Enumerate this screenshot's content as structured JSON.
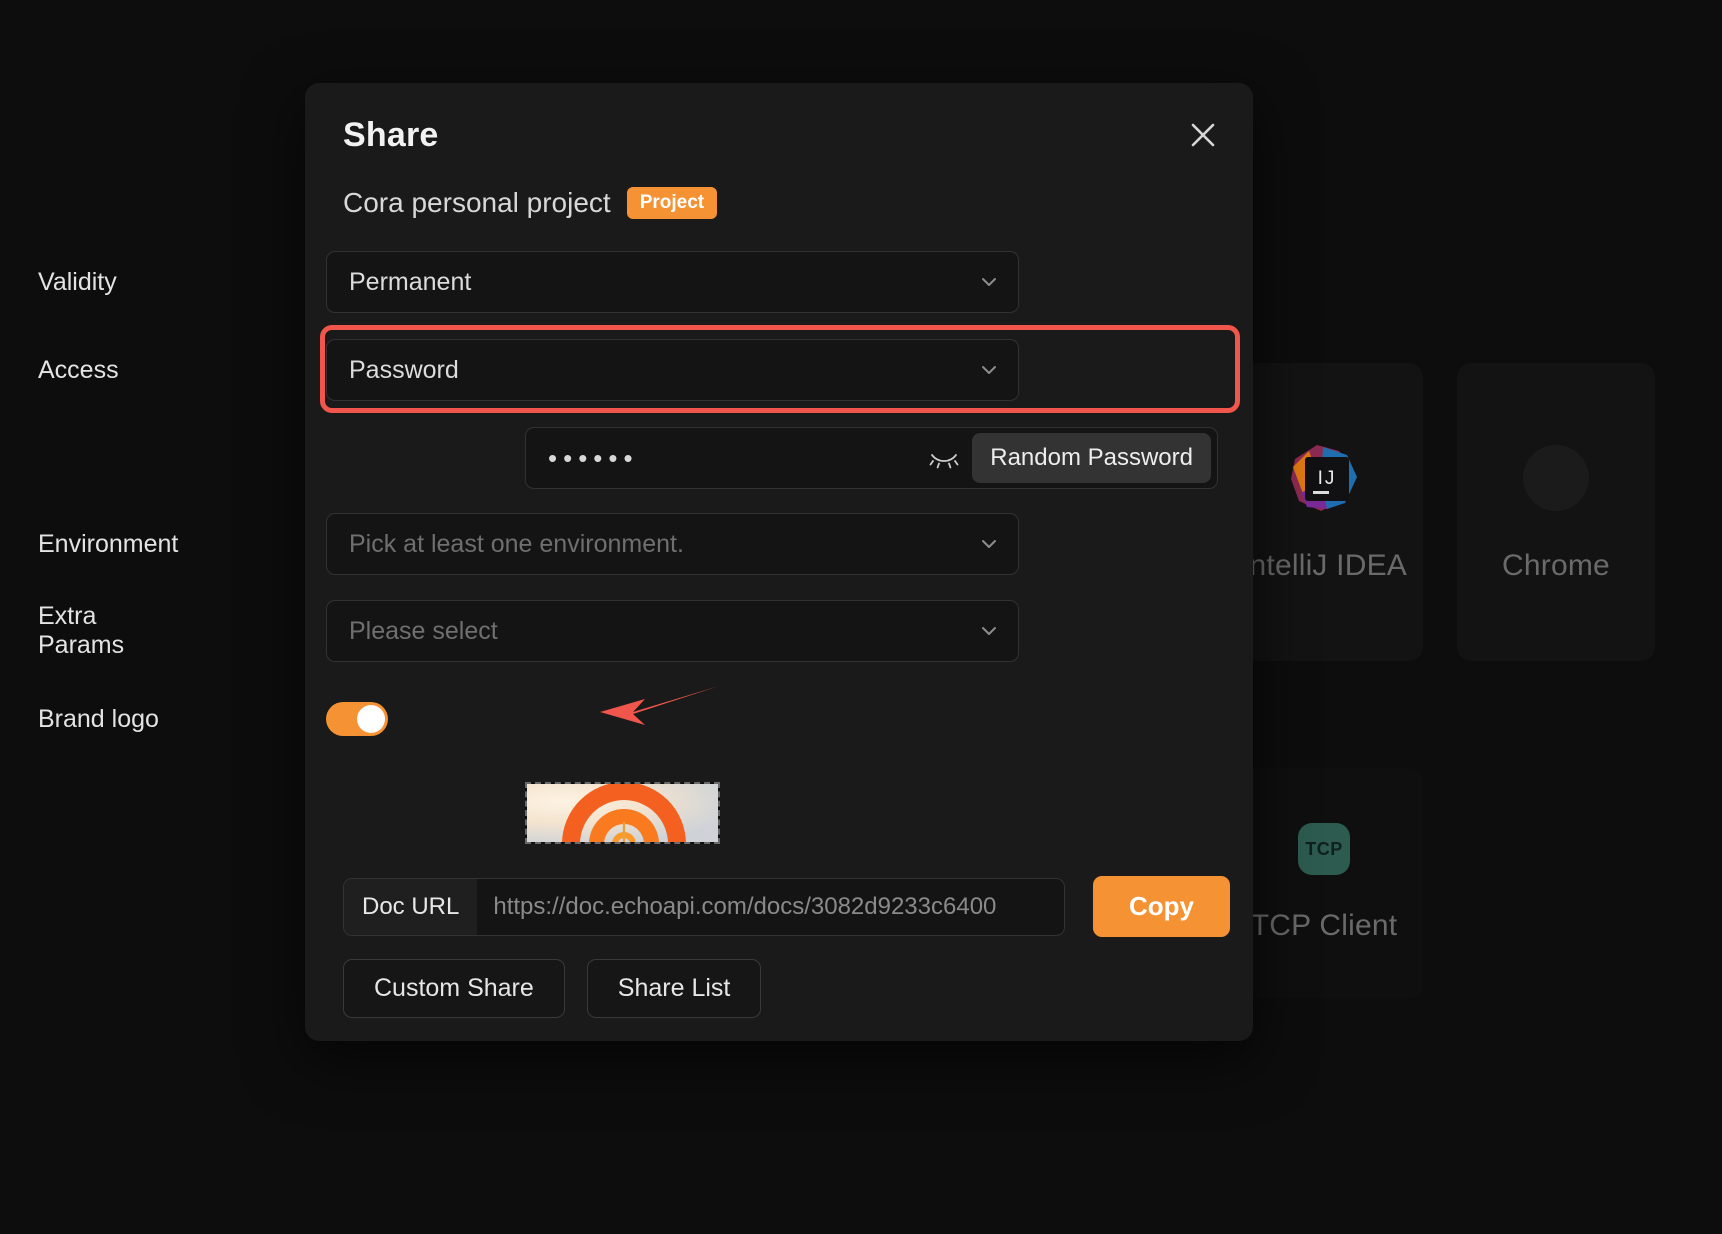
{
  "background": {
    "cards": [
      {
        "label": "IntelliJ IDEA",
        "icon": "intellij-idea-icon",
        "badge_text": "IJ"
      },
      {
        "label": "Chrome",
        "icon": "chrome-icon"
      },
      {
        "label": "TCP Client",
        "icon": "tcp-icon",
        "badge_text": "TCP"
      }
    ]
  },
  "modal": {
    "title": "Share",
    "close_icon": "close-icon",
    "project": {
      "name": "Cora personal project",
      "badge": "Project"
    },
    "rows": {
      "validity": {
        "label": "Validity",
        "value": "Permanent",
        "chevron": "chevron-down-icon"
      },
      "access": {
        "label": "Access",
        "value": "Password",
        "chevron": "chevron-down-icon"
      },
      "password": {
        "value": "••••••",
        "toggle_visibility_icon": "eye-off-icon",
        "random_button": "Random Password"
      },
      "environment": {
        "label": "Environment",
        "placeholder": "Pick at least one environment.",
        "chevron": "chevron-down-icon"
      },
      "extra_params": {
        "label": "Extra Params",
        "placeholder": "Please select",
        "chevron": "chevron-down-icon"
      },
      "brand_logo": {
        "label": "Brand logo",
        "enabled": "on",
        "thumbnail_alt": "brand-logo-thumbnail"
      }
    },
    "doc_url": {
      "label": "Doc URL",
      "value": "https://doc.echoapi.com/docs/3082d9233c6400",
      "copy_button": "Copy"
    },
    "footer": {
      "custom_share": "Custom Share",
      "share_list": "Share List"
    }
  },
  "annotations": {
    "highlight_color": "#f0564b",
    "accent_color": "#f59233",
    "arrow_target": "brand-logo-toggle"
  }
}
